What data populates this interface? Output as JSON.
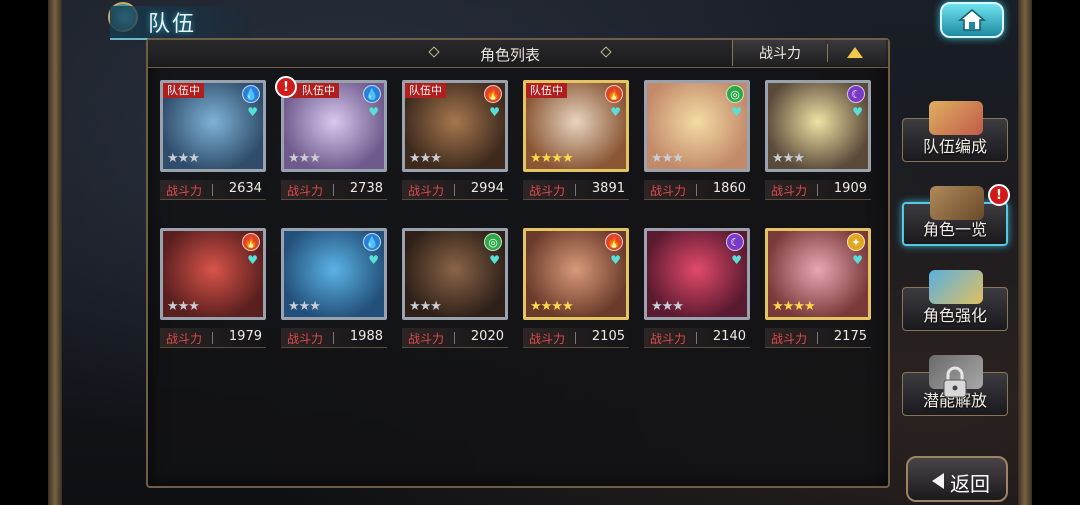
{
  "header": {
    "title": "队伍"
  },
  "panel": {
    "list_title": "角色列表",
    "sort_label": "战斗力"
  },
  "power_label": "战斗力",
  "team_tag": "队伍中",
  "alert_mark": "!",
  "characters": [
    {
      "power": "2634",
      "element": "water",
      "stars": 3,
      "gold": false,
      "in_team": true,
      "alert": false,
      "palette": [
        "#7fb3d8",
        "#2f4d6a"
      ]
    },
    {
      "power": "2738",
      "element": "water",
      "stars": 3,
      "gold": false,
      "in_team": true,
      "alert": true,
      "palette": [
        "#d8c9ee",
        "#6e5a8c"
      ]
    },
    {
      "power": "2994",
      "element": "fire",
      "stars": 3,
      "gold": false,
      "in_team": true,
      "alert": false,
      "palette": [
        "#a7774f",
        "#3d2a1d"
      ]
    },
    {
      "power": "3891",
      "element": "fire",
      "stars": 4,
      "gold": true,
      "in_team": true,
      "alert": false,
      "palette": [
        "#e7d4c0",
        "#8a5634"
      ]
    },
    {
      "power": "1860",
      "element": "wind",
      "stars": 3,
      "gold": false,
      "in_team": false,
      "alert": false,
      "palette": [
        "#f3dca4",
        "#c38a6a"
      ]
    },
    {
      "power": "1909",
      "element": "dark",
      "stars": 3,
      "gold": false,
      "in_team": false,
      "alert": false,
      "palette": [
        "#f0e2a4",
        "#5a4a3a"
      ]
    },
    {
      "power": "1979",
      "element": "fire",
      "stars": 3,
      "gold": false,
      "in_team": false,
      "alert": false,
      "palette": [
        "#d8544a",
        "#5a1f1f"
      ]
    },
    {
      "power": "1988",
      "element": "water",
      "stars": 3,
      "gold": false,
      "in_team": false,
      "alert": false,
      "palette": [
        "#5bb3e6",
        "#23507a"
      ]
    },
    {
      "power": "2020",
      "element": "wind",
      "stars": 3,
      "gold": false,
      "in_team": false,
      "alert": false,
      "palette": [
        "#8a6448",
        "#2e2018"
      ]
    },
    {
      "power": "2105",
      "element": "fire",
      "stars": 4,
      "gold": true,
      "in_team": false,
      "alert": false,
      "palette": [
        "#d89a7a",
        "#6a3a2a"
      ]
    },
    {
      "power": "2140",
      "element": "dark",
      "stars": 3,
      "gold": false,
      "in_team": false,
      "alert": false,
      "palette": [
        "#e24a6a",
        "#5a1a30"
      ]
    },
    {
      "power": "2175",
      "element": "light",
      "stars": 4,
      "gold": true,
      "in_team": false,
      "alert": false,
      "palette": [
        "#e8a8b4",
        "#7a3a3a"
      ]
    }
  ],
  "sidebar": {
    "items": [
      {
        "label": "队伍编成",
        "alert": false,
        "active": false
      },
      {
        "label": "角色一览",
        "alert": true,
        "active": true
      },
      {
        "label": "角色强化",
        "alert": false,
        "active": false
      },
      {
        "label": "潜能解放",
        "alert": false,
        "active": false,
        "locked": true
      }
    ]
  },
  "back_label": "返回",
  "colors": {
    "fire": "#d8452a",
    "water": "#2a7fd8",
    "wind": "#2fa84a",
    "dark": "#7a3ac8",
    "light": "#e0a820",
    "accent": "#56c8e0"
  }
}
